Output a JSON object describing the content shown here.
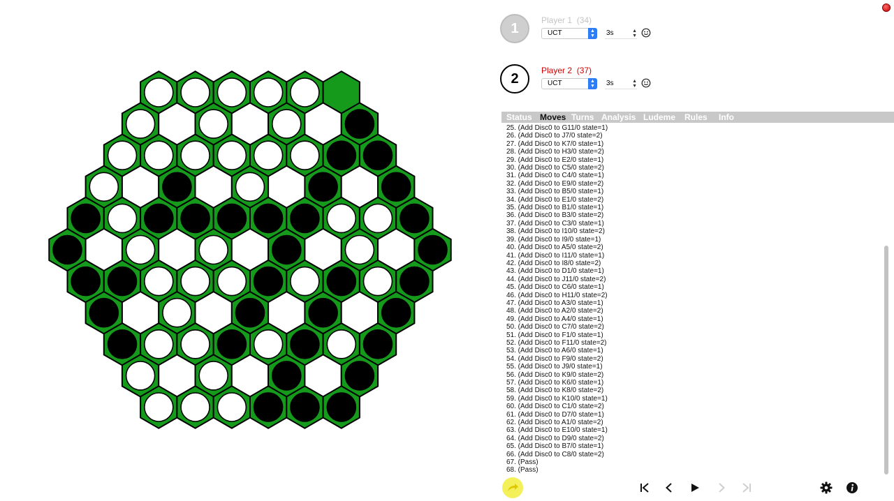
{
  "players": [
    {
      "number": "1",
      "name": "Player 1",
      "score": "(34)",
      "ai": "UCT",
      "time": "3s",
      "active": false
    },
    {
      "number": "2",
      "name": "Player 2",
      "score": "(37)",
      "ai": "UCT",
      "time": "3s",
      "active": true
    }
  ],
  "tabs": [
    "Status",
    "Moves",
    "Turns",
    "Analysis",
    "Ludeme",
    "Rules",
    "Info"
  ],
  "selected_tab": "Moves",
  "moves": [
    "25. (Add Disc0 to G11/0 state=1)",
    "26. (Add Disc0 to J7/0 state=2)",
    "27. (Add Disc0 to K7/0 state=1)",
    "28. (Add Disc0 to H3/0 state=2)",
    "29. (Add Disc0 to E2/0 state=1)",
    "30. (Add Disc0 to C5/0 state=2)",
    "31. (Add Disc0 to C4/0 state=1)",
    "32. (Add Disc0 to E9/0 state=2)",
    "33. (Add Disc0 to B5/0 state=1)",
    "34. (Add Disc0 to E1/0 state=2)",
    "35. (Add Disc0 to B1/0 state=1)",
    "36. (Add Disc0 to B3/0 state=2)",
    "37. (Add Disc0 to C3/0 state=1)",
    "38. (Add Disc0 to I10/0 state=2)",
    "39. (Add Disc0 to I9/0 state=1)",
    "40. (Add Disc0 to A5/0 state=2)",
    "41. (Add Disc0 to I11/0 state=1)",
    "42. (Add Disc0 to I8/0 state=2)",
    "43. (Add Disc0 to D1/0 state=1)",
    "44. (Add Disc0 to J11/0 state=2)",
    "45. (Add Disc0 to C6/0 state=1)",
    "46. (Add Disc0 to H11/0 state=2)",
    "47. (Add Disc0 to A3/0 state=1)",
    "48. (Add Disc0 to A2/0 state=2)",
    "49. (Add Disc0 to A4/0 state=1)",
    "50. (Add Disc0 to C7/0 state=2)",
    "51. (Add Disc0 to F1/0 state=1)",
    "52. (Add Disc0 to F11/0 state=2)",
    "53. (Add Disc0 to A6/0 state=1)",
    "54. (Add Disc0 to F9/0 state=2)",
    "55. (Add Disc0 to J9/0 state=1)",
    "56. (Add Disc0 to K9/0 state=2)",
    "57. (Add Disc0 to K6/0 state=1)",
    "58. (Add Disc0 to K8/0 state=2)",
    "59. (Add Disc0 to K10/0 state=1)",
    "60. (Add Disc0 to C1/0 state=2)",
    "61. (Add Disc0 to D7/0 state=1)",
    "62. (Add Disc0 to A1/0 state=2)",
    "63. (Add Disc0 to E10/0 state=1)",
    "64. (Add Disc0 to D9/0 state=2)",
    "65. (Add Disc0 to B7/0 state=1)",
    "66. (Add Disc0 to C8/0 state=2)",
    "67. (Pass)",
    "68. (Pass)"
  ],
  "board": {
    "colors": {
      "cell": "#159a1c",
      "cell_border": "#000000",
      "white_disc": "#ffffff",
      "black_disc": "#000000"
    },
    "rows": [
      "WWWWWG",
      "W.W.W.B",
      "WWWWWWBB",
      "W.B.W.B.B",
      "BWBBBBBWWB",
      "B.W.W.B.W.B",
      "BBWWWBWBWB",
      "B.W.B.B.B",
      "BWWBWBWB",
      "W.W.B.B",
      "WWWBBB"
    ]
  },
  "controls": [
    "hint-icon",
    "skip-to-start-icon",
    "step-back-icon",
    "play-icon",
    "step-forward-icon",
    "skip-to-end-icon",
    "settings-gear-icon",
    "info-icon"
  ]
}
